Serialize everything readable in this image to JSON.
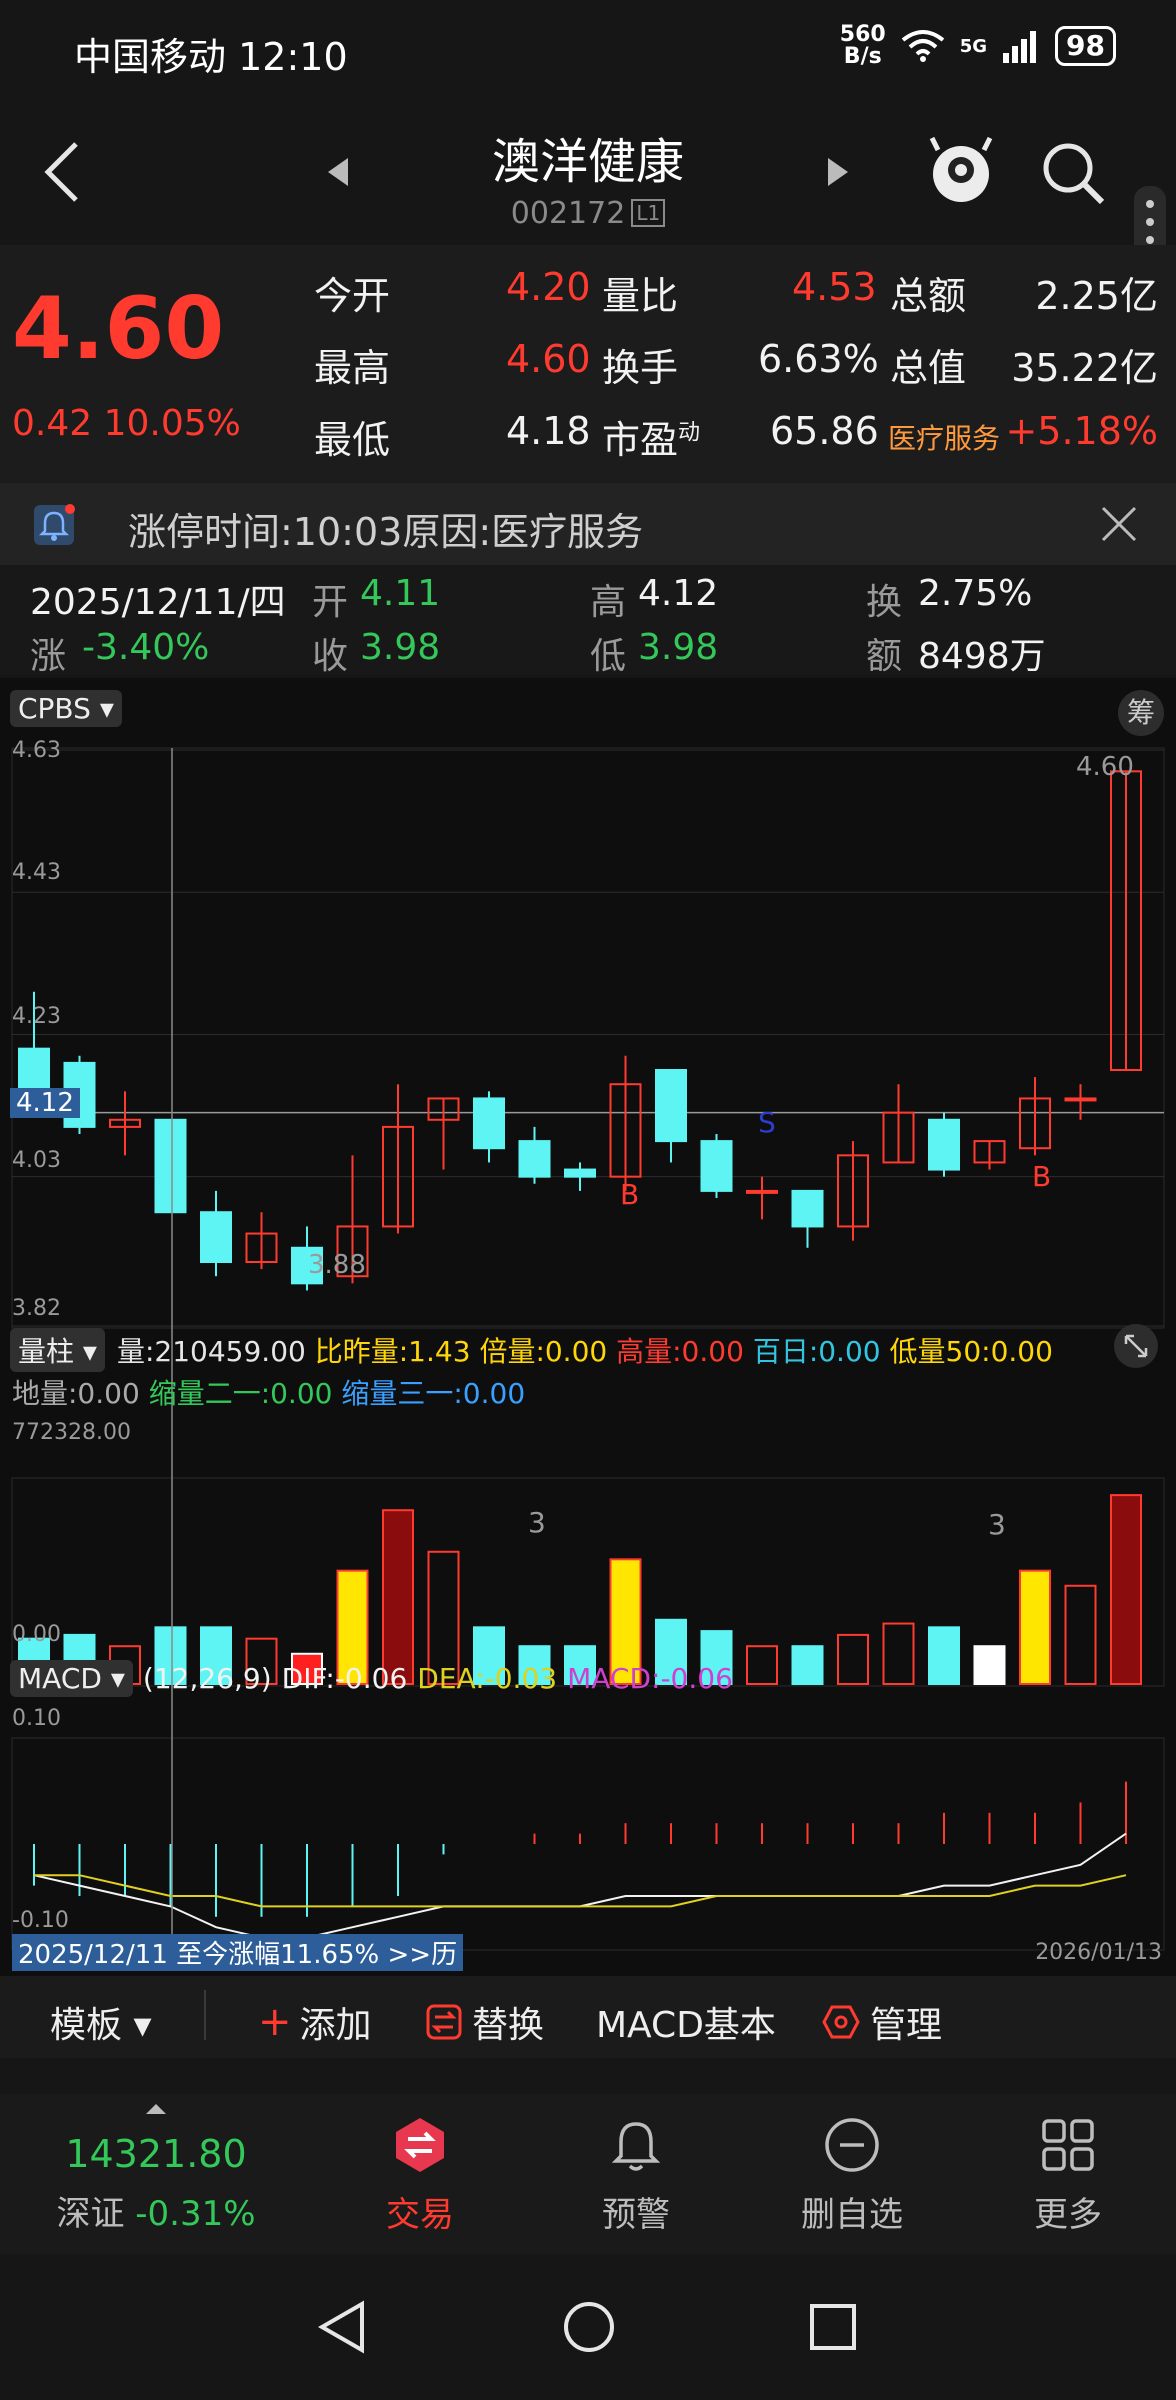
{
  "status_bar": {
    "carrier": "中国移动",
    "time": "12:10",
    "net_speed_top": "560",
    "net_speed_bottom": "B/s",
    "signal": "5G",
    "battery": "98"
  },
  "header": {
    "name": "澳洋健康",
    "code": "002172",
    "level": "L1"
  },
  "quote": {
    "price": "4.60",
    "change": "0.42",
    "change_pct": "10.05%",
    "rows": [
      {
        "l1": "今开",
        "v1": "4.20",
        "l2": "量比",
        "v2": "4.53",
        "l3": "总额",
        "v3": "2.25亿"
      },
      {
        "l1": "最高",
        "v1": "4.60",
        "l2": "换手",
        "v2": "6.63%",
        "l3": "总值",
        "v3": "35.22亿"
      },
      {
        "l1": "最低",
        "v1": "4.18",
        "l2": "市盈",
        "l2_sup": "动",
        "v2": "65.86",
        "l3": "医疗服务",
        "v3": "+5.18%"
      }
    ]
  },
  "banner": {
    "text": "涨停时间:10:03原因:医疗服务"
  },
  "day_info": {
    "date": "2025/12/11/四",
    "open_label": "开",
    "open": "4.11",
    "high_label": "高",
    "high": "4.12",
    "turnover_label": "换",
    "turnover": "2.75%",
    "chg_label": "涨",
    "chg": "-3.40%",
    "close_label": "收",
    "close": "3.98",
    "low_label": "低",
    "low": "3.98",
    "amount_label": "额",
    "amount": "8498万"
  },
  "kline": {
    "indicator": "CPBS",
    "chip_button": "筹",
    "y_ticks": [
      "4.63",
      "4.43",
      "4.23",
      "4.03",
      "3.82"
    ],
    "cursor_price": "4.12",
    "high_label": "4.60",
    "low_label": "3.88",
    "signals": [
      "B",
      "S",
      "B"
    ]
  },
  "volume": {
    "indicator": "量柱",
    "stats_line1": [
      {
        "text": "量:210459.00",
        "color": "#e6e6e6"
      },
      {
        "text": "比昨量:1.43",
        "color": "#ffd60a"
      },
      {
        "text": "倍量:0.00",
        "color": "#ffd60a"
      },
      {
        "text": "高量:0.00",
        "color": "#ff3b30"
      },
      {
        "text": "百日:0.00",
        "color": "#32c5e0"
      },
      {
        "text": "低量50:0.00",
        "color": "#ffd60a"
      }
    ],
    "stats_line2": [
      {
        "text": "地量:0.00",
        "color": "#aaaaaa"
      },
      {
        "text": "缩量二一:0.00",
        "color": "#34c759"
      },
      {
        "text": "缩量三一:0.00",
        "color": "#3aa0ff"
      }
    ],
    "max_label": "772328.00",
    "zero_label": "0.00",
    "markers": [
      "3",
      "3"
    ]
  },
  "macd": {
    "indicator": "MACD",
    "params": "(12,26,9)",
    "dif": "DIF:-0.06",
    "dea": "DEA:-0.03",
    "macd": "MACD:-0.06",
    "y_top": "0.10",
    "y_bottom": "-0.10",
    "range_text": "2025/12/11 至今涨幅11.65% >>历",
    "end_date": "2026/01/13"
  },
  "toolbar": {
    "template": "模板",
    "add": "添加",
    "replace": "替换",
    "basic": "MACD基本",
    "manage": "管理"
  },
  "bottom_nav": {
    "index_value": "14321.80",
    "index_name": "深证",
    "index_chg": "-0.31%",
    "items": [
      {
        "label": "交易"
      },
      {
        "label": "预警"
      },
      {
        "label": "删自选"
      },
      {
        "label": "更多"
      }
    ]
  },
  "colors": {
    "up": "#ff3b30",
    "down": "#5ef4f4",
    "accent": "#ff3b30",
    "dea": "#e0d020",
    "macd": "#d040d0"
  },
  "chart_data": {
    "type": "candlestick",
    "y_axis_ticks": [
      4.63,
      4.43,
      4.23,
      4.03,
      3.82
    ],
    "ylim": [
      3.82,
      4.63
    ],
    "candles": [
      {
        "o": 4.21,
        "h": 4.29,
        "c": 4.15,
        "l": 4.12
      },
      {
        "o": 4.19,
        "h": 4.2,
        "c": 4.1,
        "l": 4.09
      },
      {
        "o": 4.1,
        "h": 4.15,
        "c": 4.11,
        "l": 4.06
      },
      {
        "o": 4.11,
        "h": 4.11,
        "c": 3.98,
        "l": 3.98
      },
      {
        "o": 3.98,
        "h": 4.01,
        "c": 3.91,
        "l": 3.89
      },
      {
        "o": 3.91,
        "h": 3.98,
        "c": 3.95,
        "l": 3.9
      },
      {
        "o": 3.93,
        "h": 3.96,
        "c": 3.88,
        "l": 3.87
      },
      {
        "o": 3.89,
        "h": 4.06,
        "c": 3.96,
        "l": 3.88
      },
      {
        "o": 3.96,
        "h": 4.16,
        "c": 4.1,
        "l": 3.95
      },
      {
        "o": 4.11,
        "h": 4.14,
        "c": 4.14,
        "l": 4.04
      },
      {
        "o": 4.14,
        "h": 4.15,
        "c": 4.07,
        "l": 4.05
      },
      {
        "o": 4.08,
        "h": 4.1,
        "c": 4.03,
        "l": 4.02
      },
      {
        "o": 4.04,
        "h": 4.05,
        "c": 4.03,
        "l": 4.01
      },
      {
        "o": 4.03,
        "h": 4.2,
        "c": 4.16,
        "l": 4.01
      },
      {
        "o": 4.18,
        "h": 4.18,
        "c": 4.08,
        "l": 4.05
      },
      {
        "o": 4.08,
        "h": 4.09,
        "c": 4.01,
        "l": 4.0
      },
      {
        "o": 4.01,
        "h": 4.03,
        "c": 4.01,
        "l": 3.97
      },
      {
        "o": 4.01,
        "h": 4.01,
        "c": 3.96,
        "l": 3.93
      },
      {
        "o": 3.96,
        "h": 4.08,
        "c": 4.06,
        "l": 3.94
      },
      {
        "o": 4.05,
        "h": 4.16,
        "c": 4.12,
        "l": 4.05
      },
      {
        "o": 4.11,
        "h": 4.12,
        "c": 4.04,
        "l": 4.03
      },
      {
        "o": 4.05,
        "h": 4.08,
        "c": 4.08,
        "l": 4.04
      },
      {
        "o": 4.07,
        "h": 4.17,
        "c": 4.14,
        "l": 4.06
      },
      {
        "o": 4.14,
        "h": 4.16,
        "c": 4.14,
        "l": 4.11
      },
      {
        "o": 4.18,
        "h": 4.6,
        "c": 4.6,
        "l": 4.18
      }
    ],
    "volume_series": [
      0.12,
      0.13,
      0.1,
      0.15,
      0.15,
      0.12,
      0.08,
      0.3,
      0.46,
      0.35,
      0.15,
      0.1,
      0.1,
      0.33,
      0.17,
      0.14,
      0.1,
      0.1,
      0.13,
      0.16,
      0.15,
      0.1,
      0.3,
      0.26,
      0.5
    ],
    "macd_bars": [
      -0.04,
      -0.05,
      -0.05,
      -0.06,
      -0.07,
      -0.07,
      -0.07,
      -0.06,
      -0.05,
      -0.01,
      0.0,
      0.01,
      0.01,
      0.02,
      0.02,
      0.02,
      0.02,
      0.02,
      0.02,
      0.02,
      0.03,
      0.03,
      0.03,
      0.04,
      0.06
    ],
    "dif": [
      -0.03,
      -0.04,
      -0.05,
      -0.06,
      -0.08,
      -0.09,
      -0.09,
      -0.08,
      -0.07,
      -0.06,
      -0.06,
      -0.06,
      -0.06,
      -0.05,
      -0.05,
      -0.05,
      -0.05,
      -0.05,
      -0.05,
      -0.05,
      -0.04,
      -0.04,
      -0.03,
      -0.02,
      0.01
    ],
    "dea": [
      -0.03,
      -0.03,
      -0.04,
      -0.05,
      -0.05,
      -0.06,
      -0.06,
      -0.06,
      -0.06,
      -0.06,
      -0.06,
      -0.06,
      -0.06,
      -0.06,
      -0.06,
      -0.05,
      -0.05,
      -0.05,
      -0.05,
      -0.05,
      -0.05,
      -0.05,
      -0.04,
      -0.04,
      -0.03
    ]
  }
}
